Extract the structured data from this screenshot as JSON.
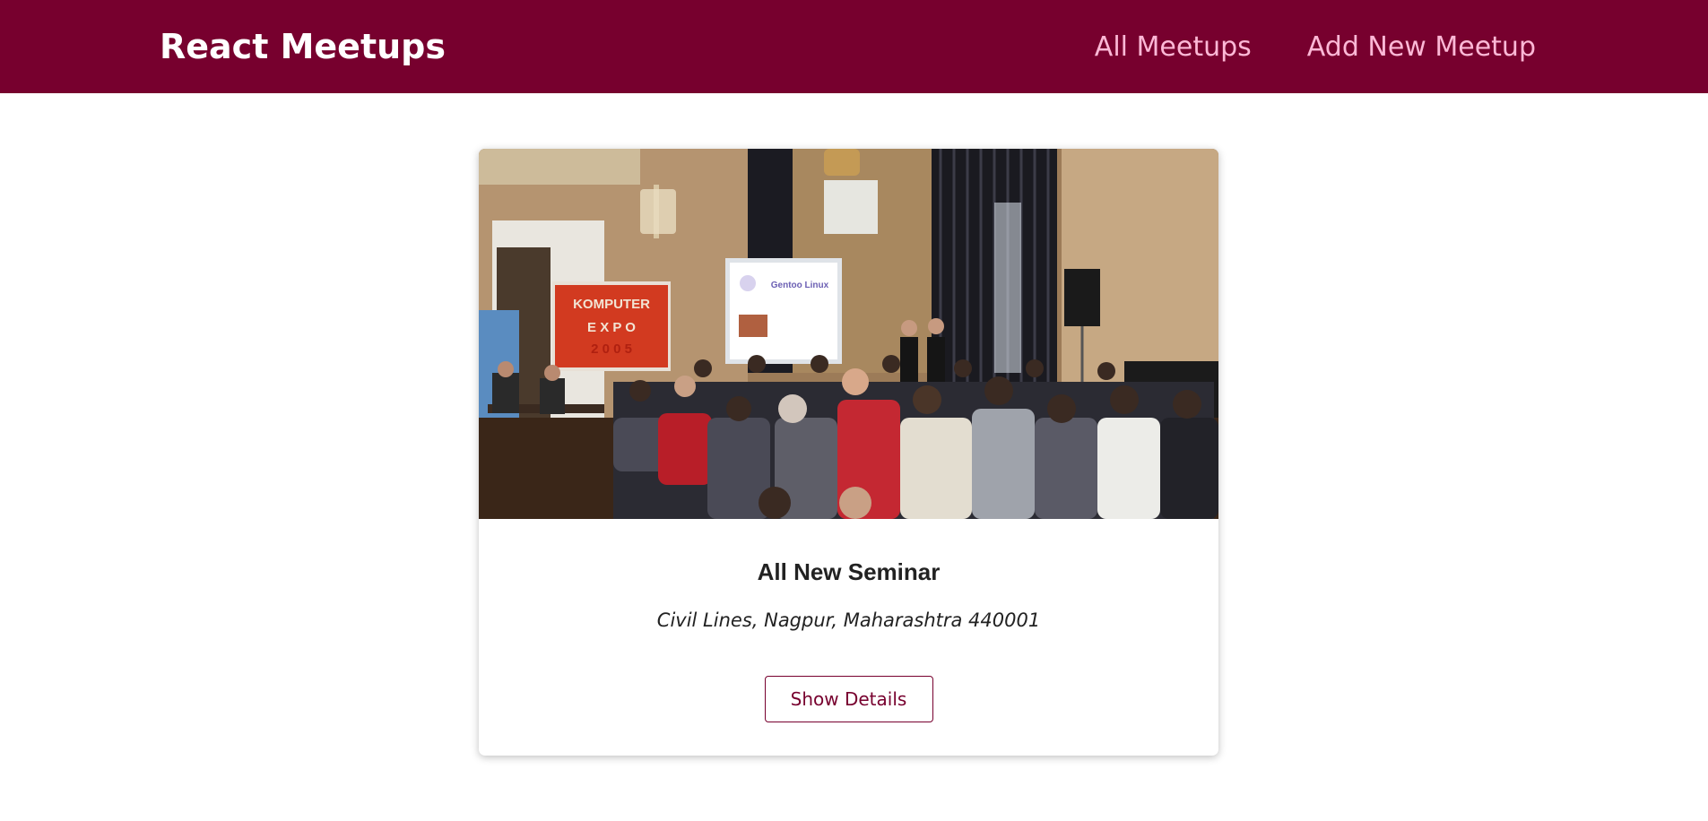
{
  "header": {
    "logo": "React Meetups",
    "nav": [
      {
        "label": "All Meetups"
      },
      {
        "label": "Add New Meetup"
      }
    ]
  },
  "meetup": {
    "image_description_icon": "meetup-photo",
    "title": "All New Seminar",
    "address": "Civil Lines, Nagpur, Maharashtra 440001",
    "action_label": "Show Details"
  },
  "colors": {
    "header_bg": "#77002e",
    "nav_link": "#fcb8d6",
    "accent": "#77002e"
  }
}
